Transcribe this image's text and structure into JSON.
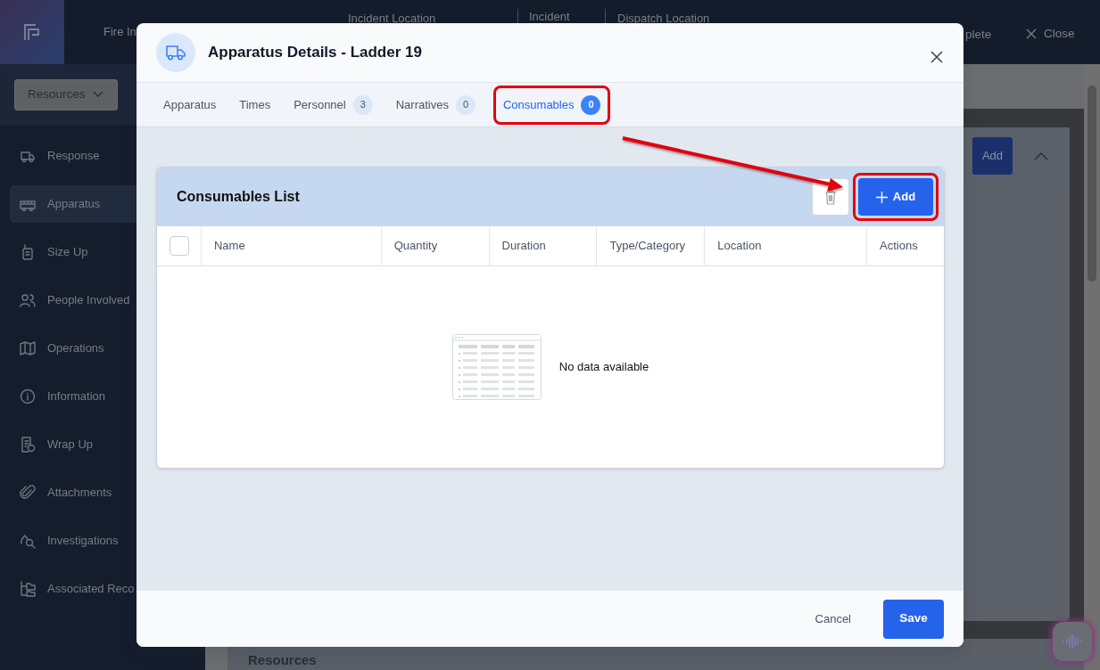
{
  "app": {
    "title": "Fire In",
    "header_fields": [
      {
        "label": "Incident Location"
      },
      {
        "label": "Incident"
      },
      {
        "label": "Dispatch Location"
      }
    ],
    "actions": [
      {
        "kind": "text",
        "label": "plete"
      },
      {
        "kind": "close",
        "label": "Close"
      }
    ],
    "dropdown": {
      "label": "Resources"
    },
    "sidebar": {
      "items": [
        {
          "kind": "truck",
          "label": "Response",
          "selected": false
        },
        {
          "kind": "firetruck",
          "label": "Apparatus",
          "selected": true
        },
        {
          "kind": "radio",
          "label": "Size Up",
          "selected": false
        },
        {
          "kind": "people",
          "label": "People Involved",
          "selected": false
        },
        {
          "kind": "map",
          "label": "Operations",
          "selected": false
        },
        {
          "kind": "info",
          "label": "Information",
          "selected": false
        },
        {
          "kind": "doc",
          "label": "Wrap Up",
          "selected": false
        },
        {
          "kind": "clip",
          "label": "Attachments",
          "selected": false
        },
        {
          "kind": "search",
          "label": "Investigations",
          "selected": false
        },
        {
          "kind": "folders",
          "label": "Associated Reco",
          "selected": false
        }
      ]
    },
    "background_card": {
      "button": "Add"
    },
    "section_title": "Resources"
  },
  "modal": {
    "title": "Apparatus Details - Ladder 19",
    "tabs": [
      {
        "label": "Apparatus",
        "selected": false,
        "highlighted": false
      },
      {
        "label": "Times",
        "selected": false,
        "highlighted": false
      },
      {
        "label": "Personnel",
        "count": "3",
        "selected": false,
        "highlighted": false
      },
      {
        "label": "Narratives",
        "count": "0",
        "selected": false,
        "highlighted": false
      },
      {
        "label": "Consumables",
        "count": "0",
        "selected": true,
        "highlighted": true
      }
    ],
    "card": {
      "title": "Consumables List",
      "select_all": {
        "checked": false
      },
      "add_button": {
        "label": "Add",
        "highlighted": true
      },
      "columns": [
        "Name",
        "Quantity",
        "Duration",
        "Type/Category",
        "Location",
        "Actions"
      ],
      "empty_text": "No data available"
    },
    "footer": {
      "cancel": "Cancel",
      "save": "Save"
    }
  }
}
